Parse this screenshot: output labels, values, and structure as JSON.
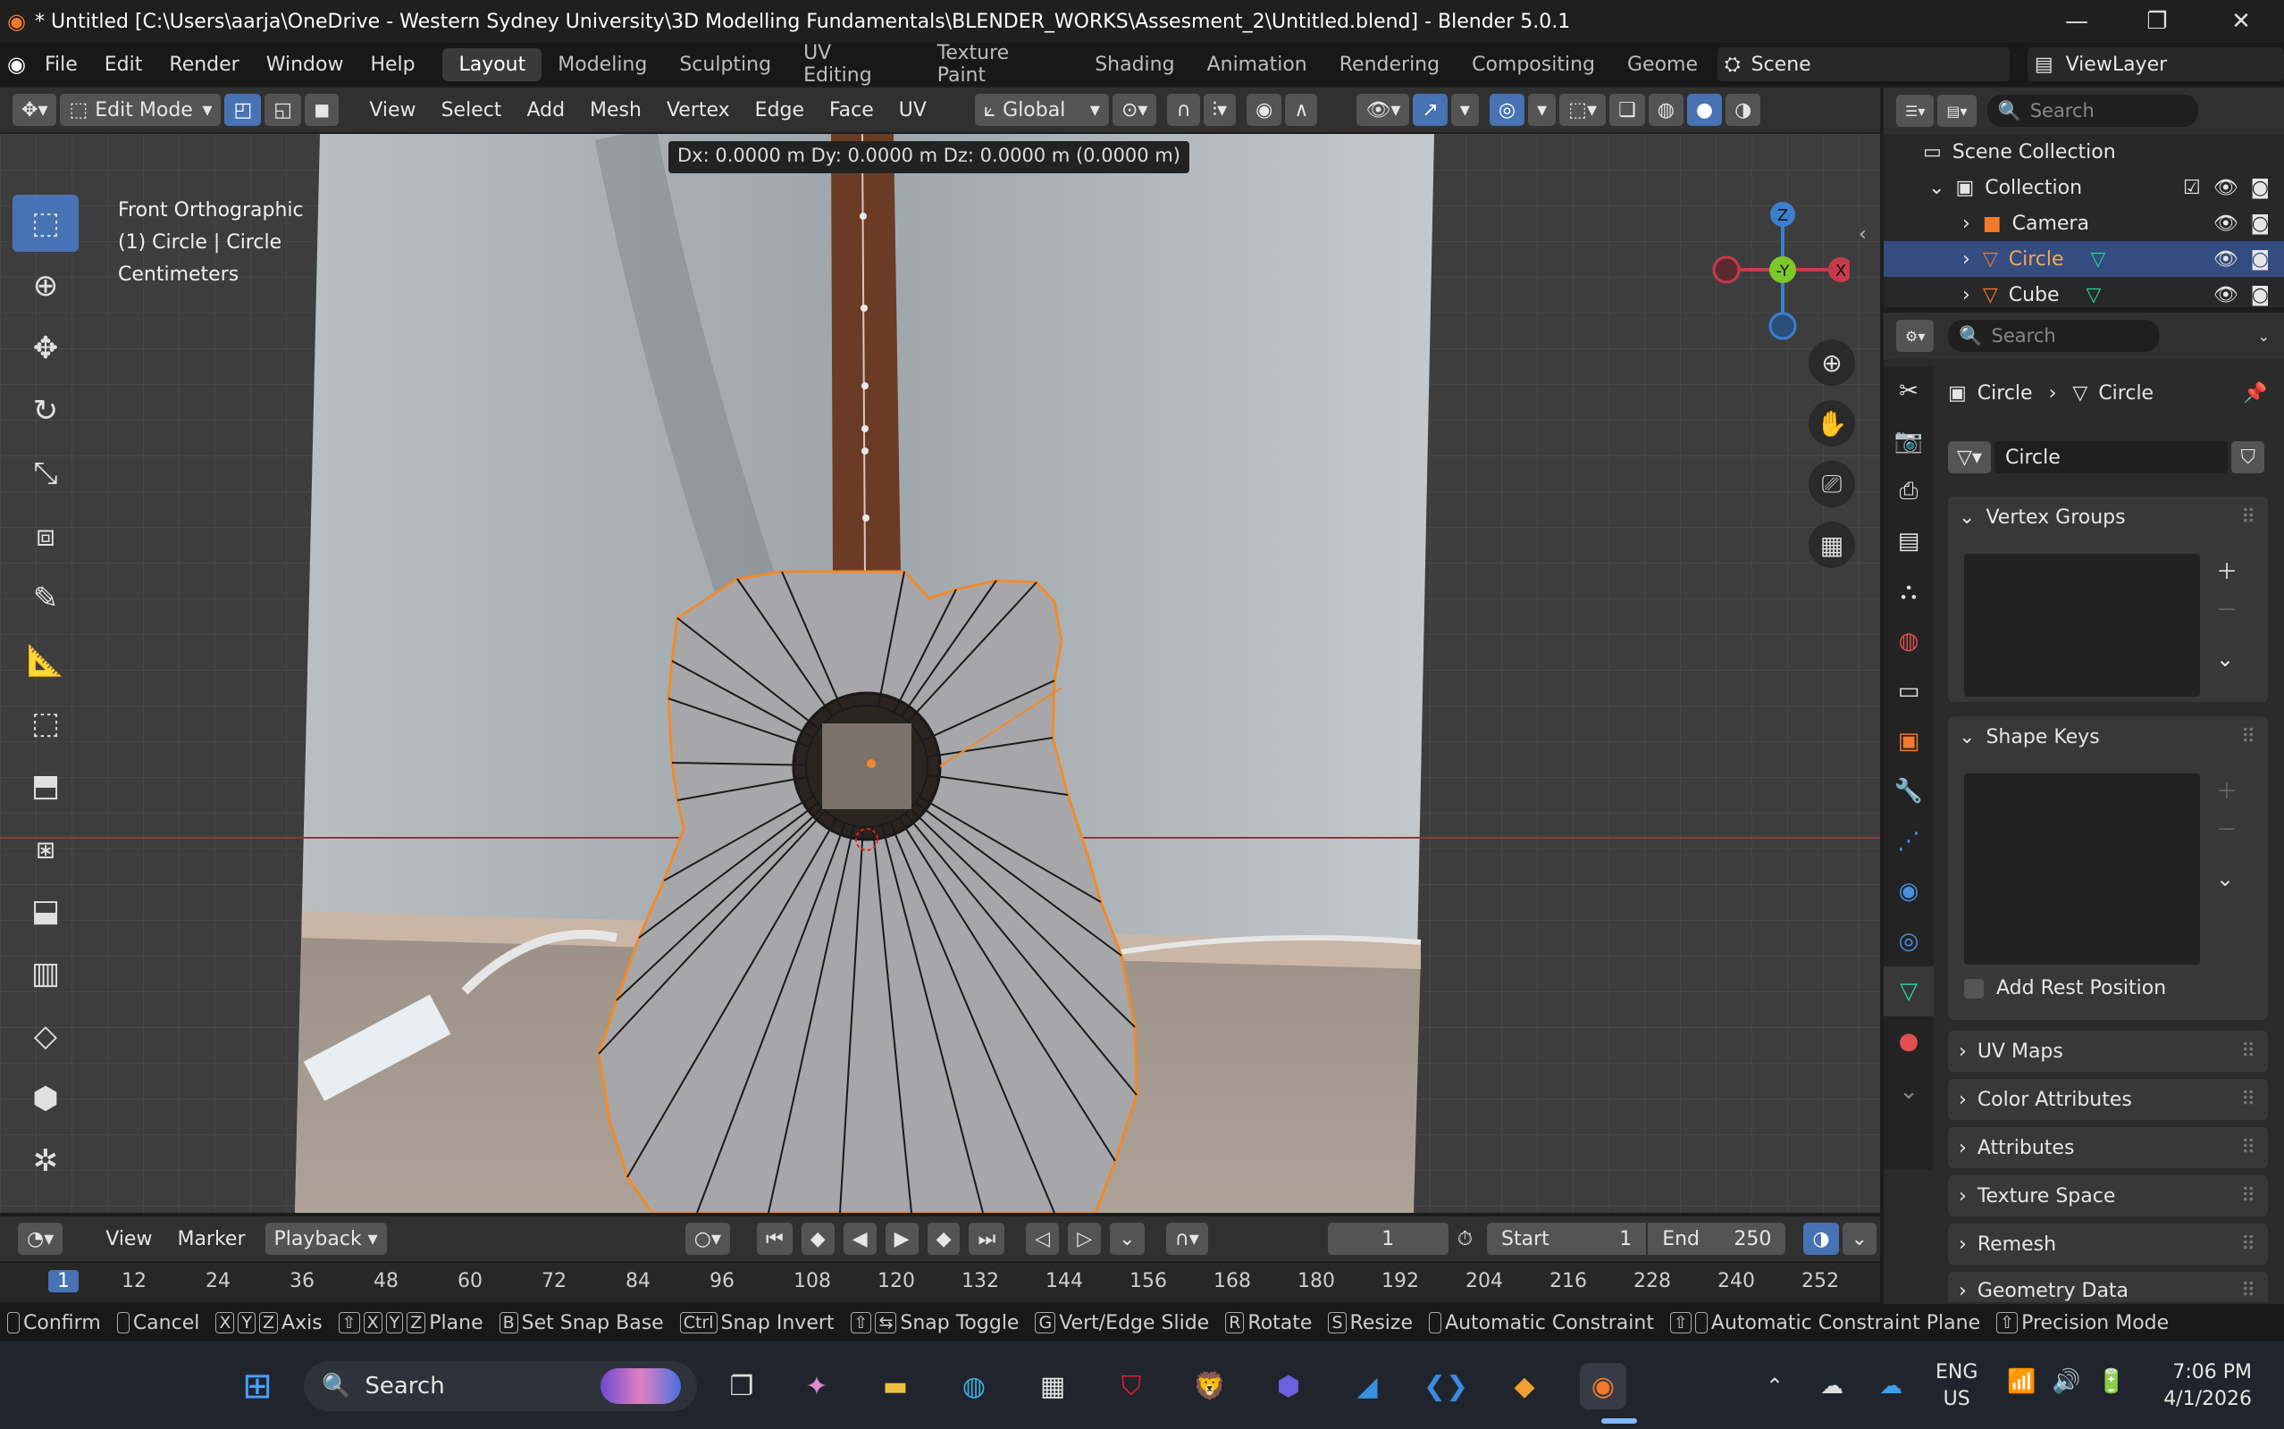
{
  "window": {
    "title": "* Untitled [C:\\Users\\aarja\\OneDrive - Western Sydney University\\3D Modelling Fundamentals\\BLENDER_WORKS\\Assesment_2\\Untitled.blend] - Blender 5.0.1",
    "minimize": "—",
    "maximize": "❐",
    "close": "✕"
  },
  "menubar": {
    "items": [
      "File",
      "Edit",
      "Render",
      "Window",
      "Help"
    ],
    "workspaces": [
      "Layout",
      "Modeling",
      "Sculpting",
      "UV Editing",
      "Texture Paint",
      "Shading",
      "Animation",
      "Rendering",
      "Compositing",
      "Geome"
    ],
    "active_workspace": "Layout",
    "scene": "Scene",
    "view_layer": "ViewLayer"
  },
  "viewport_header": {
    "mode": "Edit Mode",
    "menus": [
      "View",
      "Select",
      "Add",
      "Mesh",
      "Vertex",
      "Edge",
      "Face",
      "UV"
    ],
    "transform_orientation": "Global"
  },
  "viewport": {
    "view_name": "Front Orthographic",
    "object_info": "(1) Circle | Circle",
    "units": "Centimeters",
    "transform_readout": "Dx: 0.0000 m   Dy: 0.0000 m   Dz: 0.0000 m (0.0000 m)",
    "gizmo": {
      "z": "Z",
      "y": "-Y",
      "x": "X"
    }
  },
  "outliner": {
    "search_placeholder": "Search",
    "root": "Scene Collection",
    "collection": "Collection",
    "items": [
      {
        "name": "Camera",
        "selected": false
      },
      {
        "name": "Circle",
        "selected": true
      },
      {
        "name": "Cube",
        "selected": false
      }
    ]
  },
  "properties": {
    "search_placeholder": "Search",
    "breadcrumb": [
      "Circle",
      "Circle"
    ],
    "mesh_name": "Circle",
    "panels": {
      "vertex_groups": "Vertex Groups",
      "shape_keys": "Shape Keys",
      "add_rest_position": "Add Rest Position",
      "uv_maps": "UV Maps",
      "color_attributes": "Color Attributes",
      "attributes": "Attributes",
      "texture_space": "Texture Space",
      "remesh": "Remesh",
      "geometry_data": "Geometry Data"
    }
  },
  "timeline": {
    "menus": [
      "View",
      "Marker"
    ],
    "playback": "Playback",
    "current_frame": "1",
    "start_label": "Start",
    "start": "1",
    "end_label": "End",
    "end": "250",
    "ruler": [
      "1",
      "12",
      "24",
      "36",
      "48",
      "60",
      "72",
      "84",
      "96",
      "108",
      "120",
      "132",
      "144",
      "156",
      "168",
      "180",
      "192",
      "204",
      "216",
      "228",
      "240",
      "252"
    ]
  },
  "statusbar": [
    {
      "keys": [
        ""
      ],
      "label": "Confirm"
    },
    {
      "keys": [
        ""
      ],
      "label": "Cancel"
    },
    {
      "keys": [
        "X",
        "Y",
        "Z"
      ],
      "label": "Axis"
    },
    {
      "keys": [
        "⇧",
        "X",
        "Y",
        "Z"
      ],
      "label": "Plane"
    },
    {
      "keys": [
        "B"
      ],
      "label": "Set Snap Base"
    },
    {
      "keys": [
        "Ctrl"
      ],
      "label": "Snap Invert"
    },
    {
      "keys": [
        "⇧",
        "⇆"
      ],
      "label": "Snap Toggle"
    },
    {
      "keys": [
        "G"
      ],
      "label": "Vert/Edge Slide"
    },
    {
      "keys": [
        "R"
      ],
      "label": "Rotate"
    },
    {
      "keys": [
        "S"
      ],
      "label": "Resize"
    },
    {
      "keys": [
        ""
      ],
      "label": "Automatic Constraint"
    },
    {
      "keys": [
        "⇧",
        ""
      ],
      "label": "Automatic Constraint Plane"
    },
    {
      "keys": [
        "⇧"
      ],
      "label": "Precision Mode"
    }
  ],
  "taskbar": {
    "search_label": "Search",
    "lang_top": "ENG",
    "lang_bottom": "US",
    "time": "7:06 PM",
    "date": "4/1/2026"
  },
  "colors": {
    "accent": "#4772b3",
    "blender_orange": "#f5792a",
    "mesh_fill": "#a7a7a9"
  }
}
